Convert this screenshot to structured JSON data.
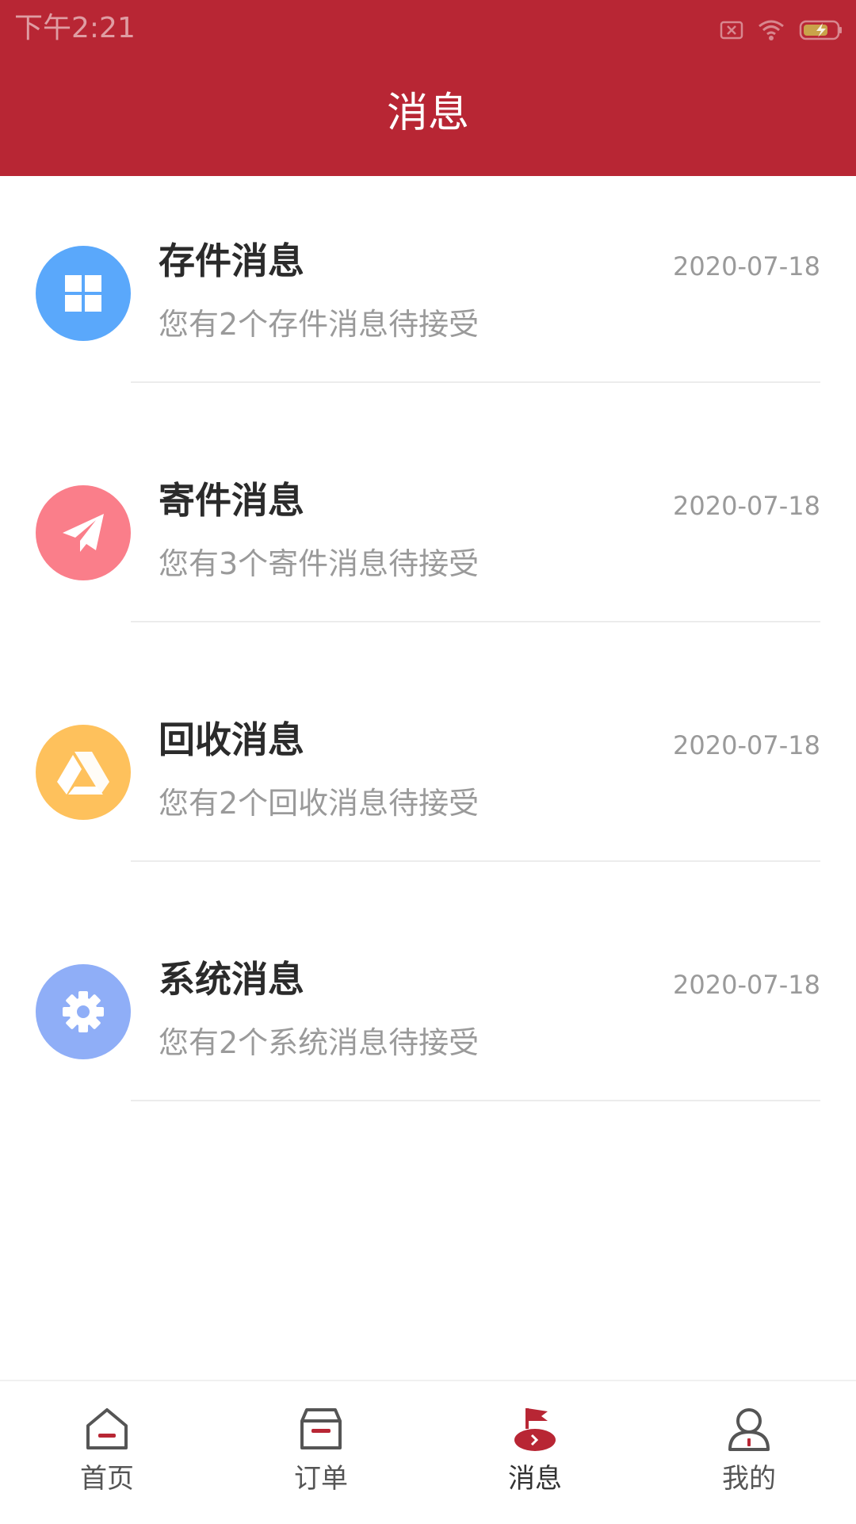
{
  "status_bar": {
    "time": "下午2:21",
    "icons": [
      "sim-off-icon",
      "wifi-icon",
      "battery-charging-icon"
    ]
  },
  "header": {
    "title": "消息",
    "background": "#b82634"
  },
  "messages": [
    {
      "title": "存件消息",
      "date": "2020-07-18",
      "desc": "您有2个存件消息待接受",
      "icon": "grid-icon",
      "color": "#5aa8fb"
    },
    {
      "title": "寄件消息",
      "date": "2020-07-18",
      "desc": "您有3个寄件消息待接受",
      "icon": "paper-plane-icon",
      "color": "#fa7e8a"
    },
    {
      "title": "回收消息",
      "date": "2020-07-18",
      "desc": "您有2个回收消息待接受",
      "icon": "triangle-logo-icon",
      "color": "#fec15c"
    },
    {
      "title": "系统消息",
      "date": "2020-07-18",
      "desc": "您有2个系统消息待接受",
      "icon": "gear-icon",
      "color": "#8faef7"
    }
  ],
  "tabbar": {
    "tabs": [
      {
        "label": "首页",
        "icon": "home-icon"
      },
      {
        "label": "订单",
        "icon": "order-box-icon"
      },
      {
        "label": "消息",
        "icon": "message-flag-icon",
        "active": true
      },
      {
        "label": "我的",
        "icon": "profile-icon"
      }
    ],
    "accent": "#b82634"
  }
}
